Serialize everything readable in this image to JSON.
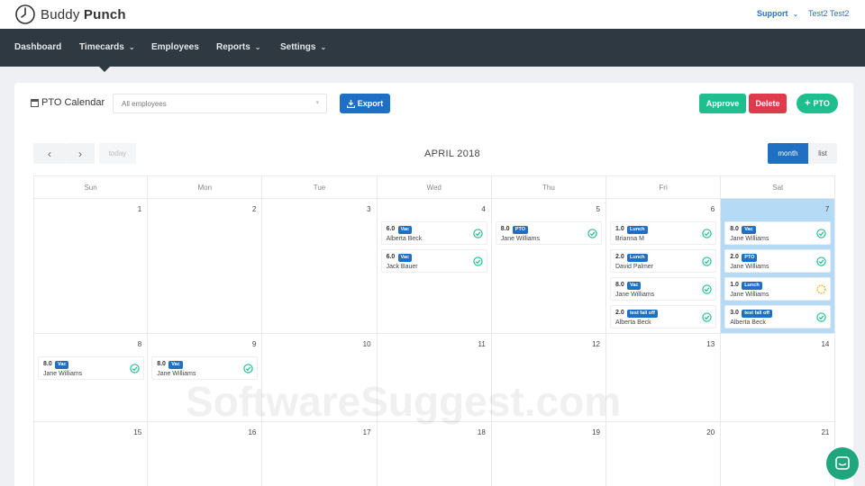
{
  "brand": {
    "name_light": "Buddy",
    "name_bold": "Punch"
  },
  "header": {
    "support_label": "Support",
    "user_name": "Test2 Test2"
  },
  "nav": [
    {
      "label": "Dashboard",
      "has_dropdown": false
    },
    {
      "label": "Timecards",
      "has_dropdown": true,
      "active": true
    },
    {
      "label": "Employees",
      "has_dropdown": false
    },
    {
      "label": "Reports",
      "has_dropdown": true
    },
    {
      "label": "Settings",
      "has_dropdown": true
    }
  ],
  "toolbar": {
    "title": "PTO Calendar",
    "employee_select_value": "All employees",
    "export_label": "Export",
    "approve_label": "Approve",
    "delete_label": "Delete",
    "add_pto_label": "PTO"
  },
  "calendar": {
    "month_title": "APRIL 2018",
    "prev_icon": "chevron-left",
    "next_icon": "chevron-right",
    "today_label": "today",
    "view_month_label": "month",
    "view_list_label": "list",
    "days_of_week": [
      "Sun",
      "Mon",
      "Tue",
      "Wed",
      "Thu",
      "Fri",
      "Sat"
    ],
    "today_day": 7,
    "weeks": [
      [
        1,
        2,
        3,
        4,
        5,
        6,
        7
      ],
      [
        8,
        9,
        10,
        11,
        12,
        13,
        14
      ],
      [
        15,
        16,
        17,
        18,
        19,
        20,
        21
      ]
    ],
    "events": [
      {
        "day": 4,
        "hours": "6.0",
        "type": "Vac",
        "employee": "Alberta Beck",
        "status": "approved"
      },
      {
        "day": 4,
        "hours": "6.0",
        "type": "Vac",
        "employee": "Jack Bauer",
        "status": "approved"
      },
      {
        "day": 5,
        "hours": "8.0",
        "type": "PTO",
        "employee": "Jane Williams",
        "status": "approved"
      },
      {
        "day": 6,
        "hours": "1.0",
        "type": "Lunch",
        "employee": "Brianna M",
        "status": "approved"
      },
      {
        "day": 6,
        "hours": "2.0",
        "type": "Lunch",
        "employee": "David Palmer",
        "status": "approved"
      },
      {
        "day": 6,
        "hours": "8.0",
        "type": "Vac",
        "employee": "Jane Williams",
        "status": "approved"
      },
      {
        "day": 6,
        "hours": "2.0",
        "type": "test fall off",
        "employee": "Alberta Beck",
        "status": "approved"
      },
      {
        "day": 7,
        "hours": "8.0",
        "type": "Vac",
        "employee": "Jane Williams",
        "status": "approved"
      },
      {
        "day": 7,
        "hours": "2.0",
        "type": "PTO",
        "employee": "Jane Williams",
        "status": "approved"
      },
      {
        "day": 7,
        "hours": "1.0",
        "type": "Lunch",
        "employee": "Jane Williams",
        "status": "pending"
      },
      {
        "day": 7,
        "hours": "3.0",
        "type": "test fall off",
        "employee": "Alberta Beck",
        "status": "approved"
      },
      {
        "day": 8,
        "hours": "8.0",
        "type": "Vac",
        "employee": "Jane Williams",
        "status": "approved"
      },
      {
        "day": 9,
        "hours": "8.0",
        "type": "Vac",
        "employee": "Jane Williams",
        "status": "approved"
      }
    ]
  },
  "watermark": "SoftwareSuggest.com",
  "colors": {
    "nav_bg": "#2f3942",
    "primary_blue": "#1f6fc5",
    "green": "#1fbe8e",
    "red": "#e03a4d",
    "today_bg": "#b5daf6",
    "pending": "#f5b431"
  }
}
